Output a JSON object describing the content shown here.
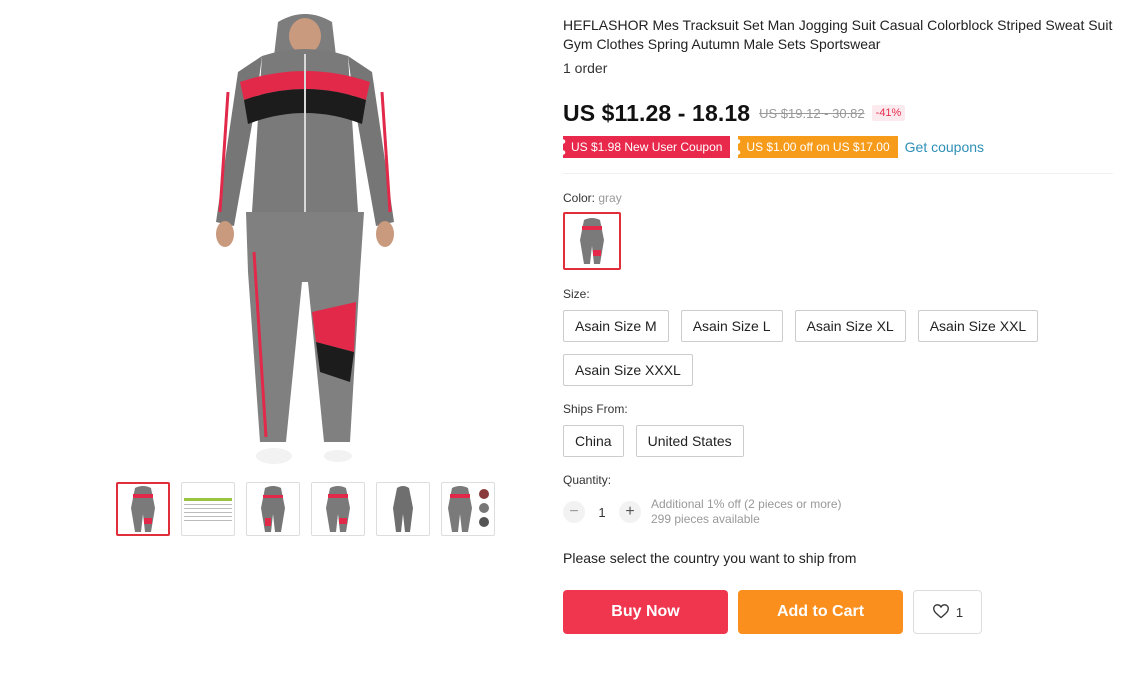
{
  "product": {
    "title": "HEFLASHOR Mes Tracksuit Set Man Jogging Suit Casual Colorblock Striped Sweat Suit Gym Clothes Spring Autumn Male Sets Sportswear",
    "orders": "1 order"
  },
  "price": {
    "current": "US $11.28 - 18.18",
    "original": "US $19.12 - 30.82",
    "discount": "-41%"
  },
  "coupons": {
    "new_user": "US $1.98 New User Coupon",
    "off": "US $1.00 off on US $17.00",
    "get_link": "Get coupons"
  },
  "color": {
    "label": "Color:",
    "selected": "gray"
  },
  "size": {
    "label": "Size:",
    "options": [
      "Asain Size M",
      "Asain Size L",
      "Asain Size XL",
      "Asain Size XXL",
      "Asain Size XXXL"
    ]
  },
  "ships_from": {
    "label": "Ships From:",
    "options": [
      "China",
      "United States"
    ]
  },
  "quantity": {
    "label": "Quantity:",
    "value": "1",
    "minus": "−",
    "plus": "+",
    "discount_note": "Additional 1% off (2 pieces or more)",
    "available": "299 pieces available"
  },
  "ship_message": "Please select the country you want to ship from",
  "actions": {
    "buy": "Buy Now",
    "cart": "Add to Cart",
    "wish_count": "1"
  },
  "colors": {
    "accent_red": "#f0354f",
    "accent_orange": "#fb8f1e",
    "link": "#2f8fb6",
    "suit_gray": "#7a7a7a"
  },
  "icons": [
    "heart-icon"
  ]
}
